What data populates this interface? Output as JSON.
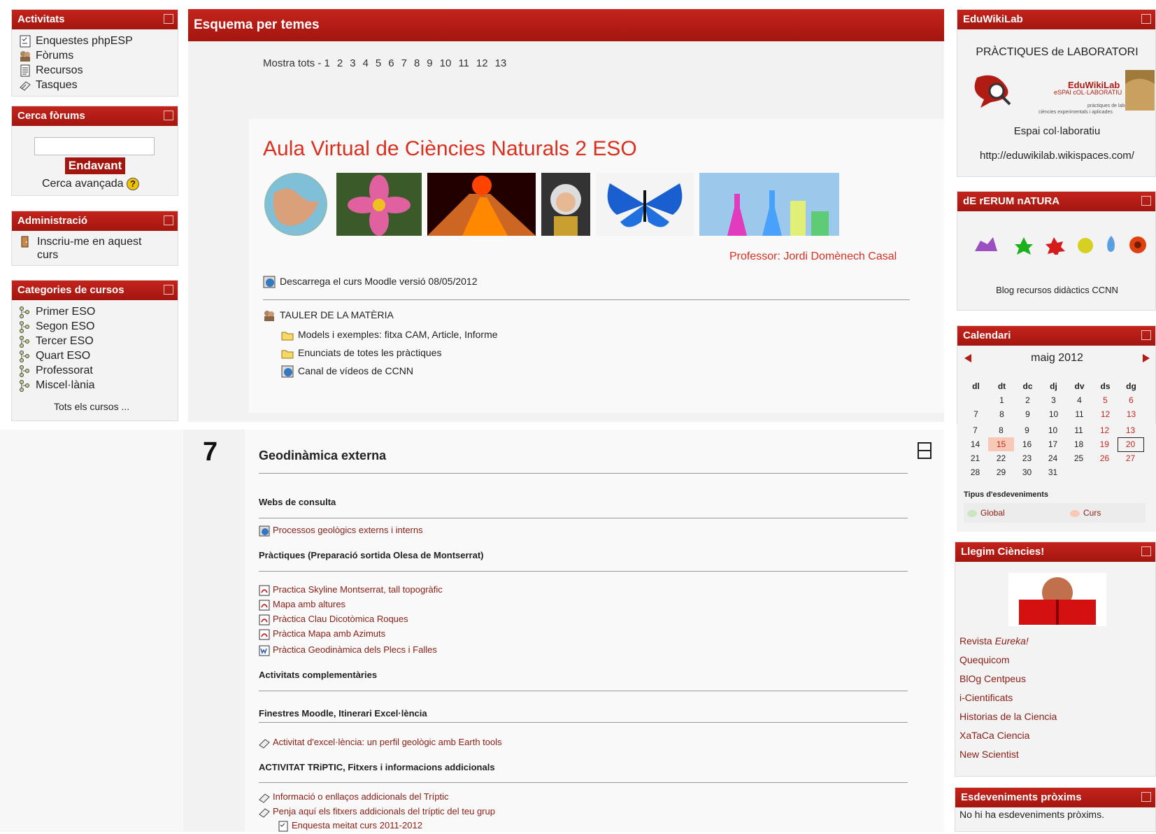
{
  "left": {
    "activitats": {
      "title": "Activitats",
      "items": [
        {
          "label": "Enquestes phpESP",
          "icon": "survey-icon"
        },
        {
          "label": "Fòrums",
          "icon": "forum-icon"
        },
        {
          "label": "Recursos",
          "icon": "resource-icon"
        },
        {
          "label": "Tasques",
          "icon": "assignment-icon"
        }
      ]
    },
    "search": {
      "title": "Cerca fòrums",
      "button": "Endavant",
      "advanced": "Cerca avançada"
    },
    "admin": {
      "title": "Administració",
      "item_line1": "Inscriu-me en aquest",
      "item_line2": "curs"
    },
    "categories": {
      "title": "Categories de cursos",
      "items": [
        "Primer ESO",
        "Segon ESO",
        "Tercer ESO",
        "Quart ESO",
        "Professorat",
        "Miscel·lània"
      ],
      "all": "Tots els cursos ..."
    }
  },
  "center": {
    "header": "Esquema per temes",
    "topics_prefix": "Mostra tots - ",
    "topics": [
      "1",
      "2",
      "3",
      "4",
      "5",
      "6",
      "7",
      "8",
      "9",
      "10",
      "11",
      "12",
      "13"
    ],
    "course_title": "Aula Virtual de Ciències Naturals 2 ESO",
    "professor": "Professor: Jordi Domènech Casal",
    "download": "Descarrega el curs Moodle versió 08/05/2012",
    "tauler": "TAULER DE LA MATÈRIA",
    "tauler_items": [
      "Models i exemples: fitxa CAM, Article, Informe",
      "Enunciats de totes les pràctiques",
      "Canal de vídeos de CCNN"
    ],
    "section7": {
      "number": "7",
      "title": "Geodinàmica externa",
      "webs": "Webs de consulta",
      "link1": "Processos geològics externs i interns",
      "practiques": "Pràctiques (Preparació sortida Olesa de Montserrat)",
      "pdfs": [
        "Practica Skyline Montserrat, tall topogràfic",
        "Mapa amb altures",
        "Pràctica Clau Dicotòmica Roques",
        "Pràctica Mapa amb Azimuts"
      ],
      "word": "Pràctica Geodinàmica dels Plecs i Falles",
      "complementaries": "Activitats complementàries",
      "finestres": "Finestres Moodle, Itinerari Excel·lència",
      "excel": "Activitat d'excel·lència: un perfil geològic amb Earth tools",
      "triptic": "ACTIVITAT TRiPTIC, Fitxers i informacions addicionals",
      "triptic_items": [
        "Informació o enllaços addicionals del Tríptic",
        "Penja aquí els fitxers addicionals del tríptic del teu grup"
      ],
      "survey": "Enquesta meitat curs 2011-2012"
    }
  },
  "right": {
    "eduwiki": {
      "title": "EduWikiLab",
      "heading": "PRÀCTIQUES de LABORATORI",
      "logo_title": "EduWikiLab",
      "logo_sub": "eSPAI cOL·LABORATIU",
      "logo_small1": "pràctiques de laboratori",
      "logo_small2": "ciències experimentals i aplicades",
      "caption": "Espai col·laboratiu",
      "url": "http://eduwikilab.wikispaces.com/"
    },
    "rerum": {
      "title": "dE rERUM nATURA",
      "caption": "Blog recursos didàctics CCNN"
    },
    "calendar": {
      "title": "Calendari",
      "month": "maig 2012",
      "days": [
        "dl",
        "dt",
        "dc",
        "dj",
        "dv",
        "ds",
        "dg"
      ],
      "rows1": [
        [
          "",
          "1",
          "2",
          "3",
          "4",
          "5",
          "6"
        ],
        [
          "7",
          "8",
          "9",
          "10",
          "11",
          "12",
          "13"
        ]
      ],
      "rows2": [
        [
          "7",
          "8",
          "9",
          "10",
          "11",
          "12",
          "13"
        ],
        [
          "14",
          "15",
          "16",
          "17",
          "18",
          "19",
          "20"
        ],
        [
          "21",
          "22",
          "23",
          "24",
          "25",
          "26",
          "27"
        ],
        [
          "28",
          "29",
          "30",
          "31",
          "",
          "",
          ""
        ]
      ],
      "events_label": "Tipus d'esdeveniments",
      "global": "Global",
      "course": "Curs"
    },
    "llegim": {
      "title": "Llegim Ciències!",
      "links": [
        "Revista ",
        "Quequicom",
        "BlOg Centpeus",
        "i-Cientificats",
        "Historias de la Ciencia",
        "XaTaCa Ciencia",
        "New Scientist"
      ],
      "eureka": "Eureka!"
    },
    "events": {
      "title": "Esdeveniments pròxims",
      "text": "No hi ha esdeveniments pròxims."
    }
  },
  "colors": {
    "header_red": "#b01c14",
    "accent": "#c8281e",
    "today": "#f9c9b8"
  }
}
